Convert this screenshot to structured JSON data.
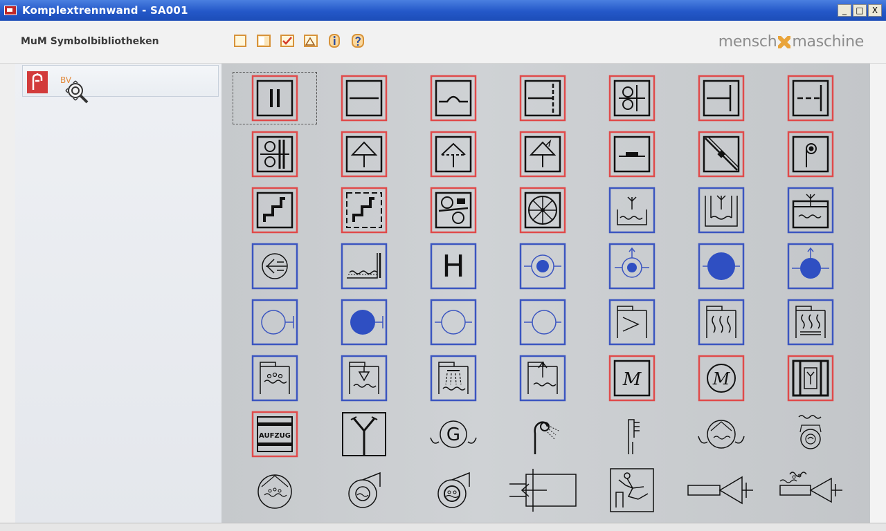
{
  "window": {
    "title": "Komplextrennwand  - SA001",
    "controls": [
      "_",
      "□",
      "X"
    ]
  },
  "header": {
    "library_title": "MuM Symbolbibliotheken",
    "tools": [
      "new-icon",
      "open-icon",
      "check-icon",
      "image-icon",
      "info-icon",
      "help-icon"
    ],
    "logo_left": "mensch",
    "logo_right": "maschine",
    "brand_color": "#e9a43a"
  },
  "sidebar": {
    "items": [
      {
        "label": "BV",
        "icon": "fire-extinguisher-icon"
      }
    ]
  },
  "colors": {
    "red_frame": "#e04a4a",
    "blue_frame": "#3b55c0",
    "blue_fill": "#2f4fc2"
  },
  "grid": {
    "rows": [
      [
        "damper-double-bar",
        "duct-line",
        "curve-line",
        "t-junction",
        "double-circle-valve",
        "t-junction-right",
        "dashed-t-junction"
      ],
      [
        "double-valve",
        "roof-vent",
        "roof-vent-open",
        "roof-vent-arrow",
        "flat-bar",
        "diagonal-damper",
        "pressure-gauge"
      ],
      [
        "stair",
        "stair-dashed",
        "fan-circles",
        "spoke-wheel",
        "water-tank",
        "water-tank-tall",
        "water-tank-boxed"
      ],
      [
        "arrow-circle",
        "water-level",
        "h-letter",
        "blue-dot-small",
        "blue-dot-arrow",
        "blue-dot-large",
        "blue-dot-arrow-large"
      ],
      [
        "circle-outline-right",
        "blue-circle-filled",
        "circle-outline",
        "circle-outline-left",
        "heater-s",
        "heater-waves",
        "heater-waves-lines"
      ],
      [
        "shower-tank",
        "shower-funnel",
        "shower-rain",
        "shower-arrow",
        "motor-box",
        "motor-circle",
        "tank-double"
      ],
      [
        "elevator",
        "y-branch",
        "generator",
        "shower-head",
        "faucet",
        "pump-wave",
        "pump-spring"
      ],
      [
        "pump-circle",
        "blower-fan",
        "blower-fan-2",
        "duct-inlet",
        "person-fall",
        "cone-duct",
        "cone-wave"
      ]
    ],
    "elevator_label": "AUFZUG",
    "generator_label": "G",
    "h_label": "H",
    "m_label": "M"
  }
}
